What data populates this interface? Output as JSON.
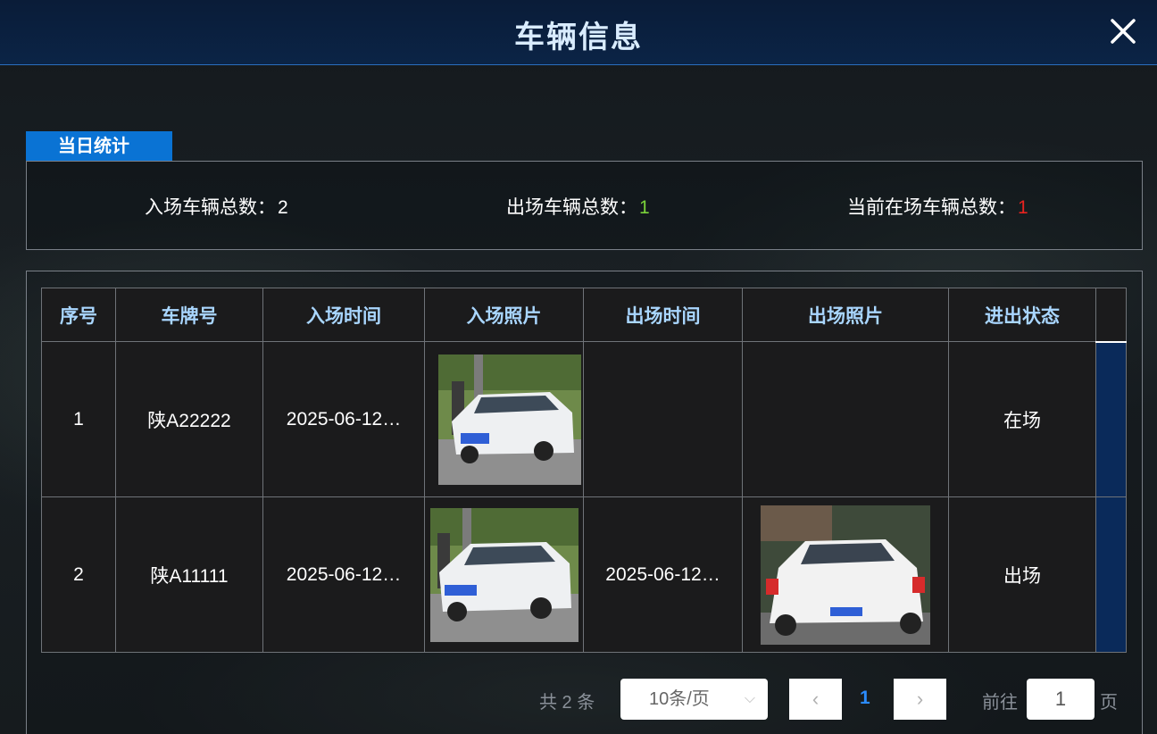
{
  "header": {
    "title": "车辆信息",
    "close_icon": "close-icon"
  },
  "stats": {
    "tab_label": "当日统计",
    "entered_label": "入场车辆总数：",
    "entered_value": "2",
    "exited_label": "出场车辆总数：",
    "exited_value": "1",
    "present_label": "当前在场车辆总数：",
    "present_value": "1",
    "colors": {
      "exited": "#7ad23a",
      "present": "#e8231f"
    }
  },
  "table": {
    "columns": [
      "序号",
      "车牌号",
      "入场时间",
      "入场照片",
      "出场时间",
      "出场照片",
      "进出状态"
    ],
    "rows": [
      {
        "index": "1",
        "plate": "陕A22222",
        "entry_time": "2025-06-12…",
        "entry_photo": "white-hatchback-front-photo",
        "exit_time": "",
        "exit_photo": "",
        "status": "在场"
      },
      {
        "index": "2",
        "plate": "陕A11111",
        "entry_time": "2025-06-12…",
        "entry_photo": "white-hatchback-front-photo",
        "exit_time": "2025-06-12…",
        "exit_photo": "white-suv-rear-photo",
        "status": "出场"
      }
    ]
  },
  "pagination": {
    "total": "共 2 条",
    "page_size": "10条/页",
    "current_page": "1",
    "goto_label": "前往",
    "goto_value": "1",
    "page_suffix": "页"
  },
  "colors": {
    "header_bg": "#0b2446",
    "accent": "#0a73d4",
    "header_text": "#a9d6ff"
  }
}
